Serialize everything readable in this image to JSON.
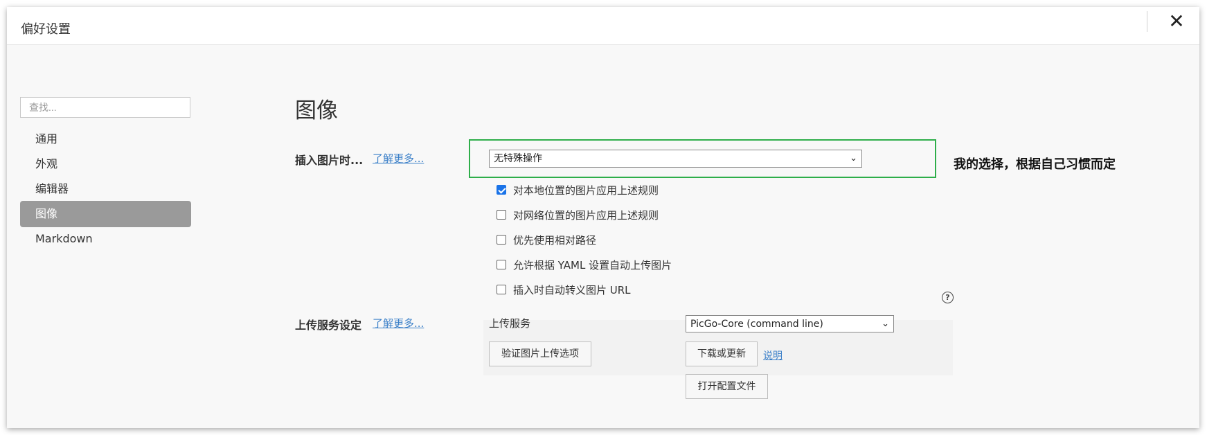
{
  "window": {
    "title": "偏好设置",
    "close_glyph": "✕"
  },
  "sidebar": {
    "search_placeholder": "查找...",
    "items": [
      {
        "label": "通用"
      },
      {
        "label": "外观"
      },
      {
        "label": "编辑器"
      },
      {
        "label": "图像",
        "active": true
      },
      {
        "label": "Markdown"
      }
    ]
  },
  "main": {
    "section_title": "图像",
    "insert_image": {
      "label": "插入图片时...",
      "learn_more": "了解更多...",
      "selected": "无特殊操作",
      "annotation": "我的选择，根据自己习惯而定",
      "highlight_color": "#2eae4a"
    },
    "options": [
      {
        "label": "对本地位置的图片应用上述规则",
        "checked": true
      },
      {
        "label": "对网络位置的图片应用上述规则",
        "checked": false
      },
      {
        "label": "优先使用相对路径",
        "checked": false
      },
      {
        "label": "允许根据 YAML 设置自动上传图片",
        "checked": false
      },
      {
        "label": "插入时自动转义图片 URL",
        "checked": false
      }
    ],
    "help_glyph": "?",
    "upload": {
      "label": "上传服务设定",
      "learn_more": "了解更多...",
      "service_label": "上传服务",
      "service_selected": "PicGo-Core (command line)",
      "validate_button": "验证图片上传选项",
      "download_button": "下载或更新",
      "explain_link": "说明",
      "open_config_button": "打开配置文件"
    }
  },
  "colors": {
    "accent": "#1a73e8",
    "link": "#3a7fc8",
    "active_nav": "#9a9a9a"
  }
}
